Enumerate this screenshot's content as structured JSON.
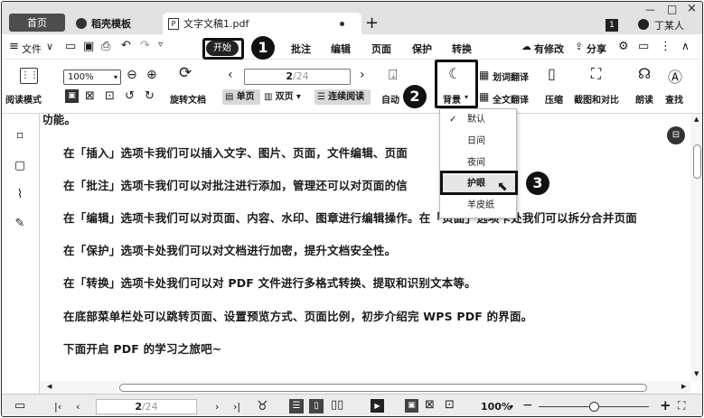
{
  "titlebar": {
    "tabs": [
      {
        "label": "首页"
      },
      {
        "label": "稻壳模板"
      },
      {
        "label": "文字文稿1.pdf"
      }
    ],
    "user": "丁某人",
    "page_badge": "1",
    "new_tab": "+"
  },
  "menu": {
    "file": "文件",
    "items": [
      "开始",
      "批注",
      "编辑",
      "页面",
      "保护",
      "转换"
    ],
    "right": [
      "有修改",
      "分享"
    ]
  },
  "toolbar": {
    "read_mode": "阅读模式",
    "zoom": "100%",
    "rotate": "旋转文档",
    "page_value": "2",
    "page_total": "/24",
    "single_page": "单页",
    "double_page": "双页",
    "continuous": "连续阅读",
    "auto": "自动",
    "background": "背景",
    "word_translate": "划词翻译",
    "full_translate": "全文翻译",
    "compress": "压缩",
    "screenshot_compare": "截图和对比",
    "read_aloud": "朗读",
    "find": "查找"
  },
  "dropdown": {
    "items": [
      "默认",
      "日间",
      "夜间",
      "护眼",
      "羊皮纸"
    ]
  },
  "document": {
    "top_cut": "功能。",
    "paragraphs": [
      "在「插入」选项卡我们可以插入文字、图片、页面，文件编辑、页面",
      "在「批注」选项卡我们可以对批注进行添加，管理还可以对页面的信",
      "在「编辑」选项卡我们可以对页面、内容、水印、图章进行编辑操作。在「页面」选项卡处我们可以拆分合并页面",
      "在「保护」选项卡处我们可以对文档进行加密，提升文档安全性。",
      "在「转换」选项卡处我们可以对 PDF 文件进行多格式转换、提取和识别文本等。",
      "在底部菜单栏处可以跳转页面、设置预览方式、页面比例，初步介绍完 WPS PDF 的界面。",
      "下面开启 PDF 的学习之旅吧~"
    ]
  },
  "status": {
    "page_value": "2",
    "page_total": "/24",
    "zoom": "100%"
  },
  "callouts": [
    "1",
    "2",
    "3"
  ]
}
